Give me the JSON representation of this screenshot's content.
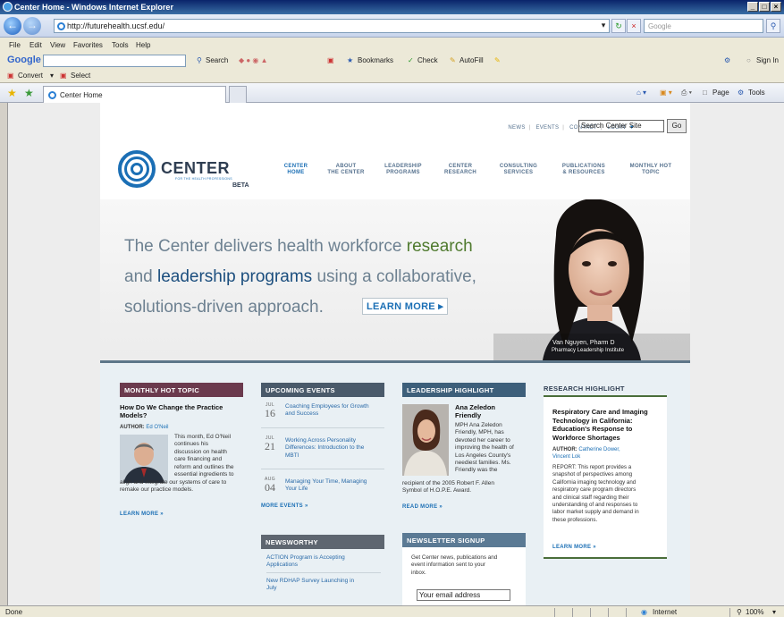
{
  "window": {
    "title": "Center Home - Windows Internet Explorer"
  },
  "address_bar": {
    "url": "http://futurehealth.ucsf.edu/",
    "search_placeholder": "Google"
  },
  "menu": [
    "File",
    "Edit",
    "View",
    "Favorites",
    "Tools",
    "Help"
  ],
  "google_toolbar": {
    "logo": "Google",
    "search_label": "Search",
    "bookmarks_label": "Bookmarks",
    "check_label": "Check",
    "autofill_label": "AutoFill",
    "signin_label": "Sign In"
  },
  "convert_bar": {
    "convert_label": "Convert",
    "select_label": "Select"
  },
  "tabs": {
    "active_tab": "Center Home",
    "page_label": "Page",
    "tools_label": "Tools"
  },
  "site": {
    "top_nav": [
      "NEWS",
      "EVENTS",
      "CONTACT",
      "LOGIN"
    ],
    "search_value": "Search Center Site",
    "go_label": "Go",
    "logo_name": "CENTER",
    "logo_sub": "FOR THE HEALTH PROFESSIONS",
    "logo_beta": "BETA",
    "main_nav": [
      {
        "line1": "CENTER",
        "line2": "HOME"
      },
      {
        "line1": "ABOUT",
        "line2": "THE CENTER"
      },
      {
        "line1": "LEADERSHIP",
        "line2": "PROGRAMS"
      },
      {
        "line1": "CENTER",
        "line2": "RESEARCH"
      },
      {
        "line1": "CONSULTING",
        "line2": "SERVICES"
      },
      {
        "line1": "PUBLICATIONS",
        "line2": "& RESOURCES"
      },
      {
        "line1": "MONTHLY HOT",
        "line2": "TOPIC"
      }
    ],
    "hero": {
      "line1_pre": "The Center delivers health workforce ",
      "line1_hl": "research",
      "line2_pre": "and ",
      "line2_hl": "leadership programs",
      "line2_post": " using a collaborative,",
      "line3": "solutions-driven approach.",
      "learn_more": "LEARN MORE",
      "caption_name": "Van Nguyen, Pharm D",
      "caption_org": "Pharmacy Leadership Institute"
    },
    "hot_topic": {
      "header": "MONTHLY HOT TOPIC",
      "title": "How Do We Change the Practice Models?",
      "author_label": "AUTHOR:",
      "author": "Ed O'Neil",
      "body_wrap": [
        "This month, Ed O'Neil",
        "continues his",
        "discussion on health",
        "care financing and",
        "reform and outlines the",
        "essential ingredients to"
      ],
      "body_full": [
        "align and integrate our systems of care to",
        "remake our practice models."
      ],
      "more": "LEARN MORE »"
    },
    "events": {
      "header": "UPCOMING EVENTS",
      "items": [
        {
          "month": "JUL",
          "day": "16",
          "title": [
            "Coaching Employees for Growth",
            "and Success"
          ]
        },
        {
          "month": "JUL",
          "day": "21",
          "title": [
            "Working Across Personality",
            "Differences: Introduction to the",
            "MBTI"
          ]
        },
        {
          "month": "AUG",
          "day": "04",
          "title": [
            "Managing Your Time, Managing",
            "Your Life"
          ]
        }
      ],
      "more": "MORE EVENTS »"
    },
    "leadership": {
      "header": "LEADERSHIP HIGHLIGHT",
      "name": [
        "Ana Zeledon",
        "Friendly"
      ],
      "body_wrap": [
        "MPH Ana Zeledon",
        "Friendly, MPH, has",
        "devoted her career to",
        "improving the health of",
        "Los Angeles County's",
        "neediest families. Ms.",
        "Friendly was the"
      ],
      "body_full": [
        "recipient of the 2005 Robert F. Allen",
        "Symbol of H.O.P.E. Award."
      ],
      "more": "READ MORE »"
    },
    "research": {
      "header": "RESEARCH HIGHLIGHT",
      "title": [
        "Respiratory Care and Imaging",
        "Technology in California:",
        "Education's Response to",
        "Workforce Shortages"
      ],
      "author_label": "AUTHOR:",
      "authors": [
        "Catherine Dower,",
        "Vincent Lok"
      ],
      "report_label": "REPORT:",
      "body": [
        "This report provides a",
        "snapshot of perspectives among",
        "California imaging technology and",
        "respiratory care program directors",
        "and clinical staff regarding their",
        "understanding of and responses to",
        "labor market supply and demand in",
        "these professions."
      ],
      "more": "LEARN MORE »"
    },
    "newsworthy": {
      "header": "NEWSWORTHY",
      "items": [
        [
          "ACTION Program is Accepting",
          "Applications"
        ],
        [
          "New RDHAP Survey Launching in",
          "July"
        ]
      ]
    },
    "newsletter": {
      "header": "NEWSLETTER SIGNUP",
      "body": [
        "Get Center news, publications and",
        "event information sent to your",
        "inbox."
      ],
      "email_value": "Your email address"
    }
  },
  "status_bar": {
    "status": "Done",
    "zone": "Internet",
    "zoom": "100%"
  },
  "colors": {
    "hot_topic_header": "#6b3a4d",
    "events_header": "#4a5a6a",
    "leadership_header": "#3d5f7a",
    "research_accent": "#4a6e3a",
    "newsworthy_header": "#5e6670",
    "newsletter_header": "#5b7a94",
    "link_blue": "#1b6fb5"
  }
}
